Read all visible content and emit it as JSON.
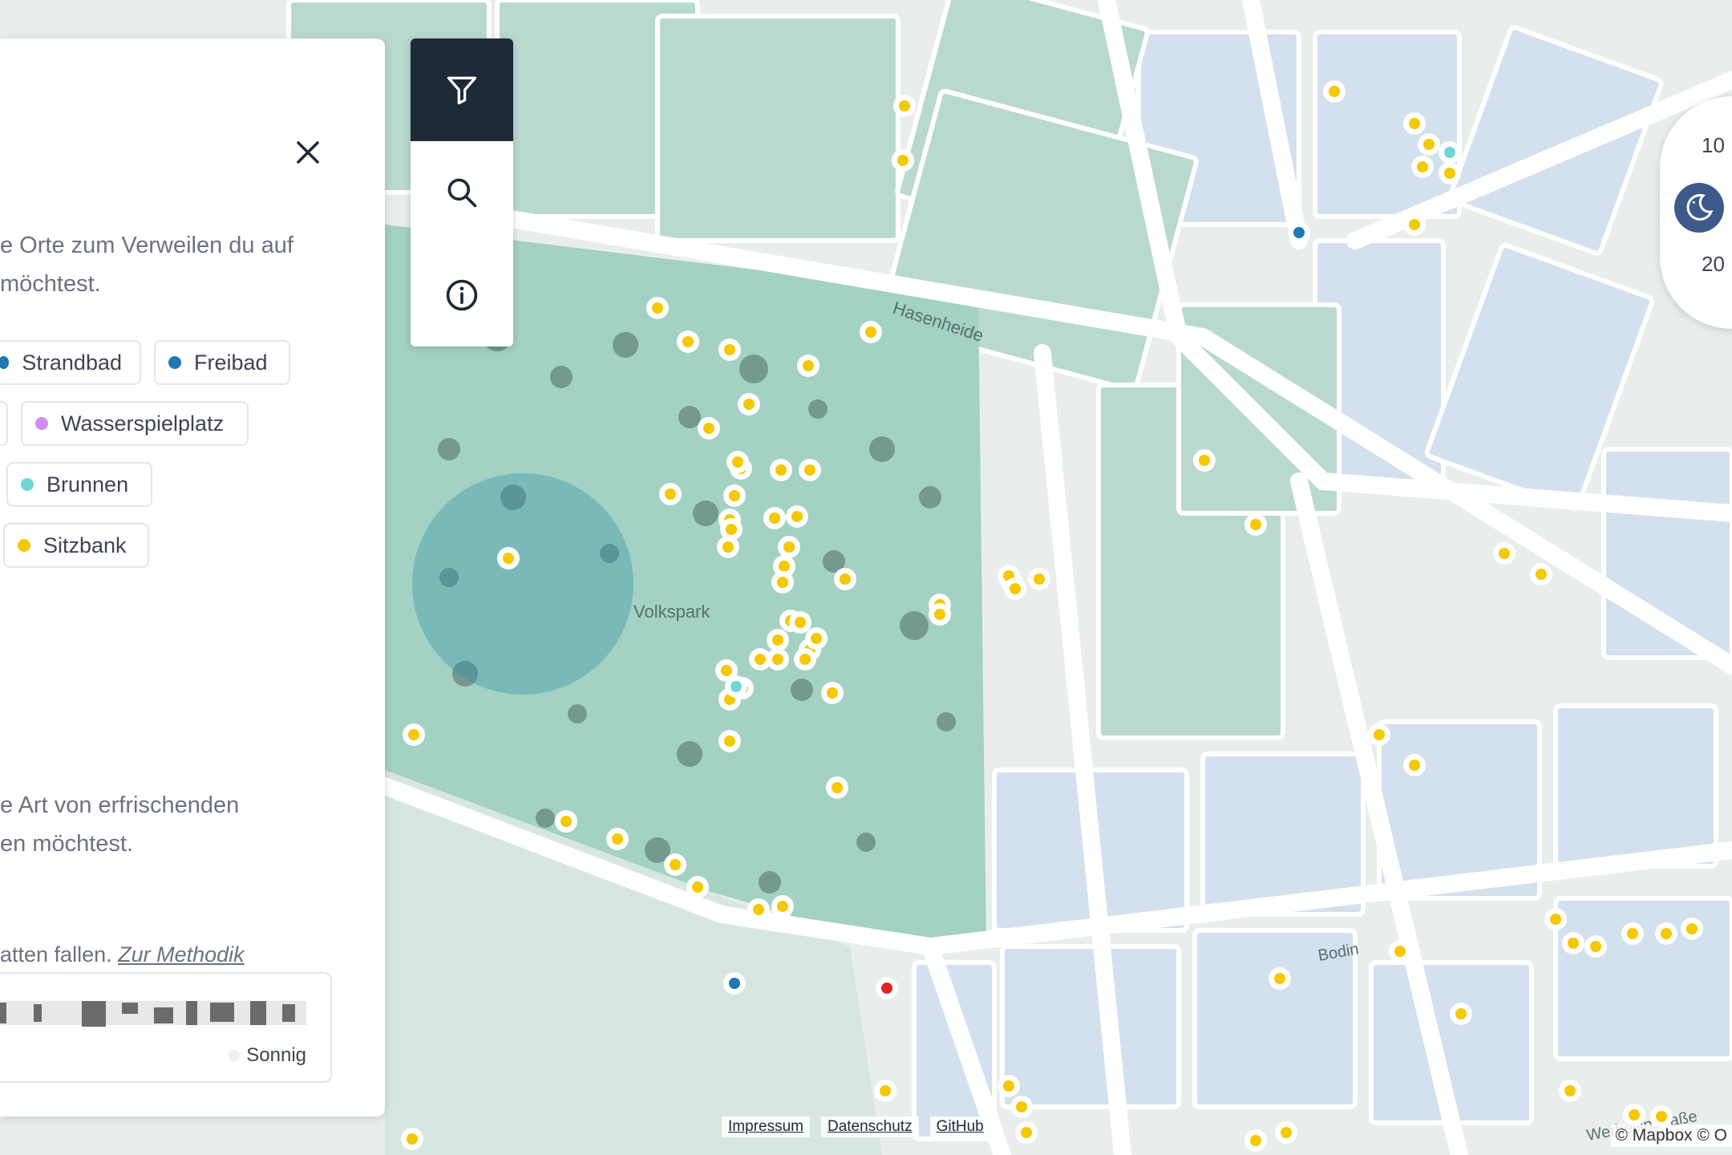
{
  "panel": {
    "text_1_line1": "e Orte zum Verweilen du auf",
    "text_1_line2": "möchtest.",
    "chips": [
      {
        "label": "Strandbad",
        "color": "#1f78b4"
      },
      {
        "label": "Freibad",
        "color": "#1f78b4"
      },
      {
        "label": "Wasserspielplatz",
        "color": "#d38cf0"
      },
      {
        "label": "Brunnen",
        "color": "#6fd6d6"
      },
      {
        "label": "Sitzbank",
        "color": "#f5c800"
      }
    ],
    "text_2_line1": "e Art von erfrischenden",
    "text_2_line2": "en möchtest.",
    "text_3": "atten fallen.",
    "method_link": "Zur Methodik",
    "legend_label": "Sonnig"
  },
  "toolbar": {
    "items": [
      "filter-icon",
      "search-icon",
      "info-icon"
    ],
    "active": "filter-icon"
  },
  "time_control": {
    "top_value": "10",
    "bottom_value": "20",
    "icon": "moon-icon"
  },
  "map_labels": {
    "street_1": "Hasenheide",
    "street_2": "Volkspark",
    "street_3": "Bodin",
    "street_4": "Werbellinstraße"
  },
  "footer": {
    "impressum": "Impressum",
    "datenschutz": "Datenschutz",
    "github": "GitHub",
    "attribution": "© Mapbox © O"
  },
  "marker_colors": {
    "sitzbank": "#f5c800",
    "brunnen": "#6fd6d6",
    "freibad": "#1f78b4",
    "selected": "#e02424",
    "park": "#a9d6c8",
    "blocks": "#d7e3ef"
  }
}
